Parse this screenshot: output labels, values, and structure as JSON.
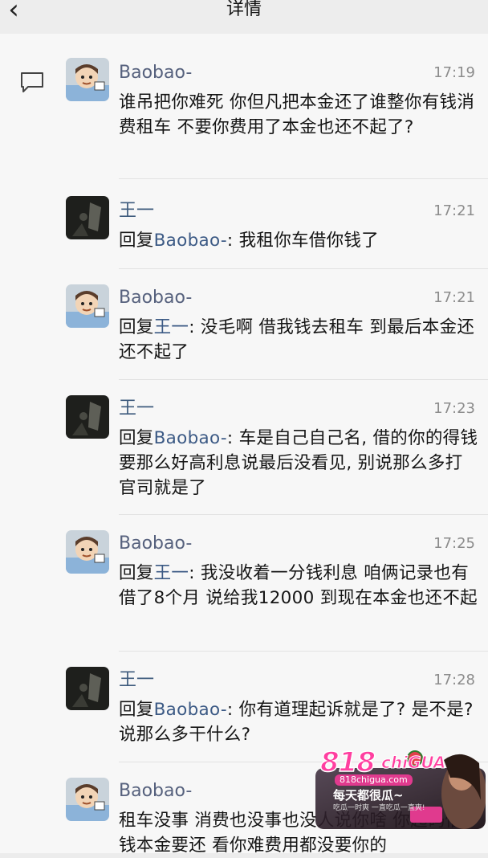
{
  "header": {
    "back_label": "‹",
    "title": "详情"
  },
  "messages": [
    {
      "name": "Baobao-",
      "time": "17:19",
      "reply_prefix": "",
      "reply_target": "",
      "body": "谁吊把你难死 你但凡把本金还了谁整你有钱消费租车 不要你费用了本金也还不起了?"
    },
    {
      "name": "王一",
      "time": "17:21",
      "reply_prefix": "回复",
      "reply_target": "Baobao-",
      "body": ": 我租你车借你钱了"
    },
    {
      "name": "Baobao-",
      "time": "17:21",
      "reply_prefix": "回复",
      "reply_target": "王一",
      "body": ": 没毛啊 借我钱去租车 到最后本金还还不起了"
    },
    {
      "name": "王一",
      "time": "17:23",
      "reply_prefix": "回复",
      "reply_target": "Baobao-",
      "body": ": 车是自己自己名, 借的你的得钱要那么好高利息说最后没看见, 别说那么多打官司就是了"
    },
    {
      "name": "Baobao-",
      "time": "17:25",
      "reply_prefix": "回复",
      "reply_target": "王一",
      "body": ": 我没收着一分钱利息 咱俩记录也有借了8个月 说给我12000 到现在本金也还不起"
    },
    {
      "name": "王一",
      "time": "17:28",
      "reply_prefix": "回复",
      "reply_target": "Baobao-",
      "body": ": 你有道理起诉就是了? 是不是? 说那么多干什么?"
    },
    {
      "name": "Baobao-",
      "time": "",
      "reply_prefix": "",
      "reply_target": "",
      "body": "租车没事 消费也没事也没人说你啥 你起码借钱本金要还 看你难费用都没要你的"
    }
  ],
  "ad": {
    "logo": "818",
    "logo_suffix": "chiGUA",
    "domain": "818chigua.com",
    "slogan": "每天都很瓜~",
    "sub": "吃瓜一时爽 一直吃瓜一直爽!"
  },
  "colors": {
    "name_link": "#56617d",
    "reply_target": "#3c5a85",
    "ad_pink": "#ff3fa0"
  }
}
